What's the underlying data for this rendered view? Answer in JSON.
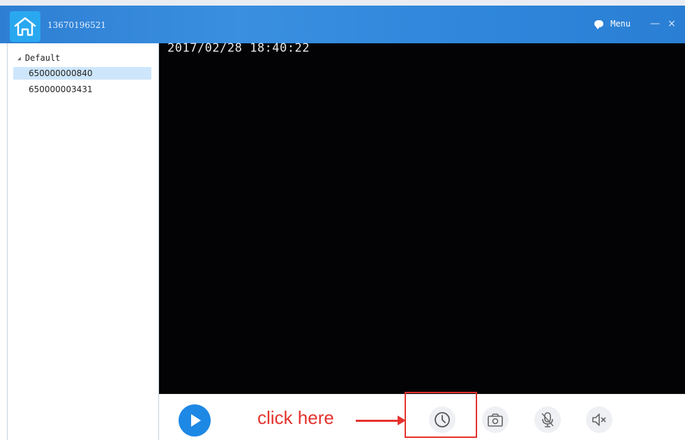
{
  "window": {
    "title": "13670196521",
    "menu_label": "Menu",
    "minimize_glyph": "—",
    "close_glyph": "×",
    "accent_color": "#2f86db"
  },
  "sidebar": {
    "group": {
      "label": "Default",
      "expanded": true
    },
    "devices": [
      {
        "id": "650000000840",
        "selected": true
      },
      {
        "id": "650000003431",
        "selected": false
      }
    ]
  },
  "video": {
    "timestamp": "2017/02/28 18:40:22"
  },
  "controls": {
    "icons": [
      "play-icon",
      "history-clock-icon",
      "snapshot-camera-icon",
      "microphone-icon",
      "speaker-mute-icon"
    ]
  },
  "annotation": {
    "text": "click here",
    "color": "#e5322d"
  }
}
